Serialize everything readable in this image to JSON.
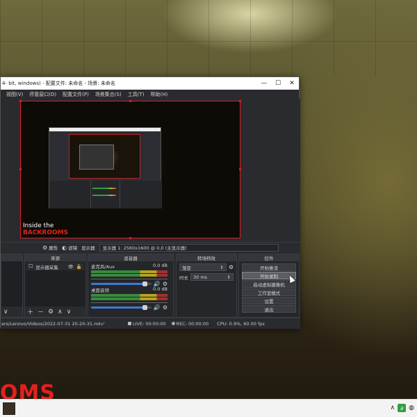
{
  "window": {
    "title": "4- bit, windows) - 配置文件: 未命名 - 场景: 未命名",
    "controls": {
      "minimize": "—",
      "maximize": "☐",
      "close": "✕"
    }
  },
  "menu": [
    "视图(V)",
    "停靠窗口(D)",
    "配置文件(P)",
    "场景集合(S)",
    "工具(T)",
    "帮助(H)"
  ],
  "preview": {
    "caption_line1": "Inside the",
    "caption_line2": "BACKROOMS"
  },
  "source_toolbar": {
    "properties": "属性",
    "filters": "滤镜",
    "display_label": "显示器",
    "display_value": "显示器 1: 2560x1600 @ 0,0 (主显示器)"
  },
  "docks": {
    "scenes_footer": "∨",
    "sources": {
      "title": "来源",
      "items": [
        {
          "name": "显示器采集"
        }
      ]
    },
    "mixer": {
      "title": "混音器",
      "channels": [
        {
          "name": "麦克风/Aux",
          "db": "0.0 dB",
          "volume_fraction": 1.0
        },
        {
          "name": "桌面音频",
          "db": "0.0 dB",
          "volume_fraction": 1.0
        }
      ]
    },
    "transitions": {
      "title": "转场特效",
      "selected": "渐变",
      "duration_label": "时长",
      "duration_value": "30 ms"
    },
    "controls": {
      "title": "控件",
      "buttons": [
        "开始推流",
        "开始录制",
        "启动虚拟摄像机",
        "工作室模式",
        "设置",
        "退出"
      ]
    }
  },
  "status": {
    "path": "ers/Lenovo/Videos/2022-07-31 20-20-31.mkv'",
    "live": "LIVE: 00:00:00",
    "rec": "REC: 00:00:00",
    "cpu": "CPU: 0.9%, 60.00 fps"
  },
  "background": {
    "text": "OMS"
  },
  "colors": {
    "accent_red": "#e2211d",
    "obs_bg": "#2a2b2f"
  }
}
